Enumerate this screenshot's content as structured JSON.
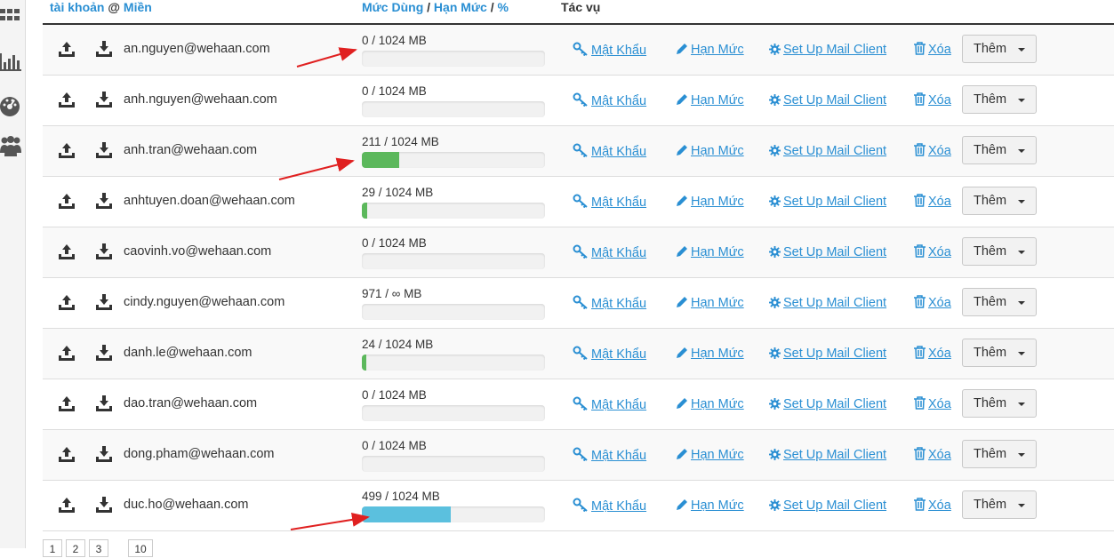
{
  "header": {
    "col_account": "tài khoản",
    "col_at": "@",
    "col_domain": "Miền",
    "col_usage": "Mức Dùng",
    "col_quota": "Hạn Mức",
    "col_percent": "%",
    "col_actions": "Tác vụ",
    "sep": "/"
  },
  "sidebar": {
    "icons": [
      "grid-icon",
      "bar-chart-icon",
      "dashboard-gauge-icon",
      "users-icon"
    ]
  },
  "actions": {
    "password": "Mật Khẩu",
    "quota": "Hạn Mức",
    "mail_client": "Set Up Mail Client",
    "delete": "Xóa",
    "more": "Thêm"
  },
  "colors": {
    "link": "#2a8fd3",
    "bar_green": "#5cb85c",
    "bar_blue": "#5bc0de",
    "arrow_red": "#e02020"
  },
  "accounts": [
    {
      "email": "an.nguyen@wehaan.com",
      "usage": "0 / 1024 MB",
      "fraction": 0,
      "color": "green"
    },
    {
      "email": "anh.nguyen@wehaan.com",
      "usage": "0 / 1024 MB",
      "fraction": 0,
      "color": "green"
    },
    {
      "email": "anh.tran@wehaan.com",
      "usage": "211 / 1024 MB",
      "fraction": 0.206,
      "color": "green"
    },
    {
      "email": "anhtuyen.doan@wehaan.com",
      "usage": "29 / 1024 MB",
      "fraction": 0.028,
      "color": "green"
    },
    {
      "email": "caovinh.vo@wehaan.com",
      "usage": "0 / 1024 MB",
      "fraction": 0,
      "color": "green"
    },
    {
      "email": "cindy.nguyen@wehaan.com",
      "usage": "971 / ∞ MB",
      "fraction": 0,
      "color": "green"
    },
    {
      "email": "danh.le@wehaan.com",
      "usage": "24 / 1024 MB",
      "fraction": 0.023,
      "color": "green"
    },
    {
      "email": "dao.tran@wehaan.com",
      "usage": "0 / 1024 MB",
      "fraction": 0,
      "color": "green"
    },
    {
      "email": "dong.pham@wehaan.com",
      "usage": "0 / 1024 MB",
      "fraction": 0,
      "color": "green"
    },
    {
      "email": "duc.ho@wehaan.com",
      "usage": "499 / 1024 MB",
      "fraction": 0.487,
      "color": "blue"
    }
  ],
  "pagination": [
    "1",
    "2",
    "3",
    "10"
  ]
}
